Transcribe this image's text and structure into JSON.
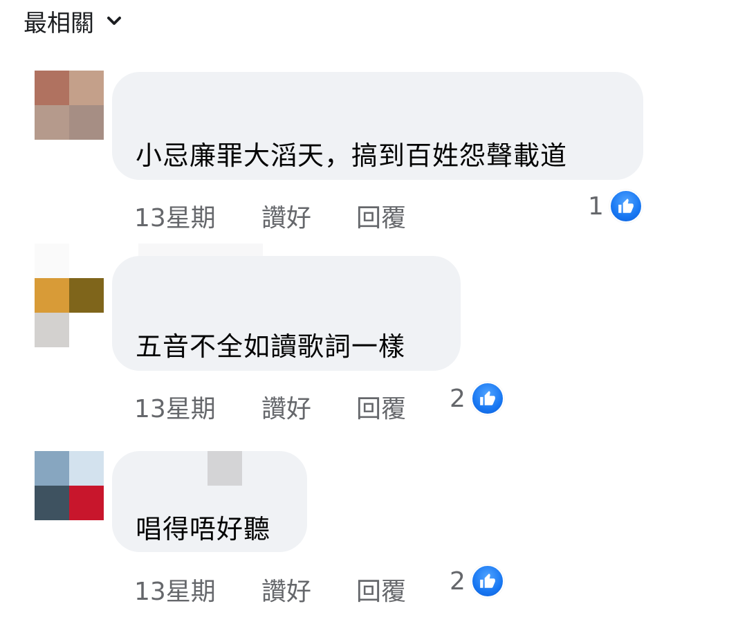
{
  "sort": {
    "label": "最相關",
    "icon": "chevron-down-icon"
  },
  "comments": [
    {
      "text": "小忌廉罪大滔天，搞到百姓怨聲載道",
      "time": "13星期",
      "like_label": "讚好",
      "reply_label": "回覆",
      "reaction_count": "1",
      "reaction_icon": "thumbs-up-icon",
      "avatar_colors": [
        "#b07260",
        "#c4a08a",
        "#b59a8c",
        "#a68e84"
      ]
    },
    {
      "text": "五音不全如讀歌詞一樣",
      "time": "13星期",
      "like_label": "讚好",
      "reply_label": "回覆",
      "reaction_count": "2",
      "reaction_icon": "thumbs-up-icon",
      "avatar_colors": [
        "#d89b37",
        "#7f651b",
        "#d3d1cf",
        "#ffffff"
      ]
    },
    {
      "text": "唱得唔好聽",
      "time": "13星期",
      "like_label": "讚好",
      "reply_label": "回覆",
      "reaction_count": "2",
      "reaction_icon": "thumbs-up-icon",
      "avatar_colors": [
        "#87a6c0",
        "#d3e2ee",
        "#3e5260",
        "#c8162c"
      ]
    }
  ],
  "colors": {
    "bubble": "#f0f2f5",
    "meta_text": "#65676b",
    "comment_text": "#050505",
    "like_blue": "#1877f2"
  }
}
